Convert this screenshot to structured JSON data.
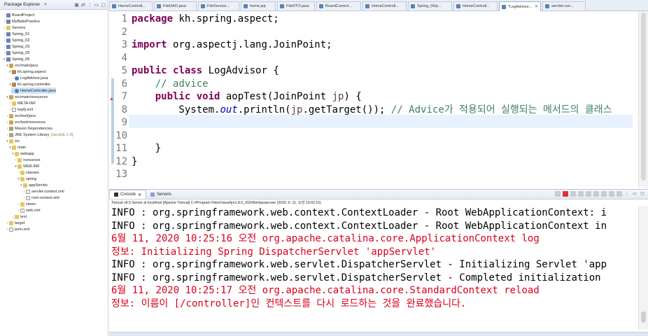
{
  "explorer": {
    "title": "Package Explorer",
    "tree": [
      {
        "label": "BoardProject",
        "icon": "project-icon"
      },
      {
        "label": "MyBatisPractice",
        "icon": "project-icon"
      },
      {
        "label": "Servers",
        "icon": "folder-icon"
      },
      {
        "label": "Spring_01",
        "icon": "project-icon"
      },
      {
        "label": "Spring_02",
        "icon": "project-icon"
      },
      {
        "label": "Spring_03",
        "icon": "project-icon"
      },
      {
        "label": "Spring_05",
        "icon": "project-icon"
      },
      {
        "label": "Spring_06",
        "icon": "project-icon"
      },
      {
        "label": "src/main/java",
        "icon": "source-folder-icon"
      },
      {
        "label": "kh.spring.aspect",
        "icon": "package-icon"
      },
      {
        "label": "LogAdvisor.java",
        "icon": "java-file-icon"
      },
      {
        "label": "kh.spring.controller",
        "icon": "package-icon"
      },
      {
        "label": "HomeController.java",
        "icon": "java-file-icon"
      },
      {
        "label": "src/main/resources",
        "icon": "source-folder-icon"
      },
      {
        "label": "META-INF",
        "icon": "folder-icon"
      },
      {
        "label": "log4j.xml",
        "icon": "xml-file-icon"
      },
      {
        "label": "src/test/java",
        "icon": "source-folder-icon"
      },
      {
        "label": "src/test/resources",
        "icon": "source-folder-icon"
      },
      {
        "label": "Maven Dependencies",
        "icon": "library-icon"
      },
      {
        "label": "JRE System Library",
        "note": "[JavaSE-1.8]",
        "icon": "library-icon"
      },
      {
        "label": "src",
        "icon": "folder-icon"
      },
      {
        "label": "main",
        "icon": "folder-icon"
      },
      {
        "label": "webapp",
        "icon": "folder-icon"
      },
      {
        "label": "resources",
        "icon": "folder-icon"
      },
      {
        "label": "WEB-INF",
        "icon": "folder-icon"
      },
      {
        "label": "classes",
        "icon": "folder-icon"
      },
      {
        "label": "spring",
        "icon": "folder-icon"
      },
      {
        "label": "appServlet",
        "icon": "folder-icon"
      },
      {
        "label": "servlet-context.xml",
        "icon": "xml-file-icon"
      },
      {
        "label": "root-context.xml",
        "icon": "xml-file-icon"
      },
      {
        "label": "views",
        "icon": "folder-icon"
      },
      {
        "label": "web.xml",
        "icon": "xml-file-icon"
      },
      {
        "label": "test",
        "icon": "folder-icon"
      },
      {
        "label": "target",
        "icon": "folder-icon"
      },
      {
        "label": "pom.xml",
        "icon": "xml-file-icon"
      }
    ]
  },
  "tabs": [
    {
      "label": "HomeControll..."
    },
    {
      "label": "FileDAO.java"
    },
    {
      "label": "FileService..."
    },
    {
      "label": "home.jsp"
    },
    {
      "label": "FileDTO.java"
    },
    {
      "label": "BoardControl..."
    },
    {
      "label": "HomeControll..."
    },
    {
      "label": "Spring_06/p..."
    },
    {
      "label": "HomeControll..."
    },
    {
      "label": "*LogAdvisor...",
      "active": true
    },
    {
      "label": "servlet-con..."
    }
  ],
  "editor": {
    "line_numbers": [
      "1",
      "2",
      "3",
      "4",
      "5",
      "6",
      "7",
      "8",
      "9",
      "10",
      "11",
      "12",
      "13"
    ],
    "lines": {
      "l1_kw": "package",
      "l1_rest": " kh.spring.aspect;",
      "l3_kw": "import",
      "l3_rest": " org.aspectj.lang.JoinPoint;",
      "l5_kw1": "public",
      "l5_kw2": "class",
      "l5_rest": " LogAdvisor {",
      "l6_comment": "    // advice",
      "l7_kw1": "public",
      "l7_kw2": "void",
      "l7_mid": " aopTest(JoinPoint ",
      "l7_var": "jp",
      "l7_end": ") {",
      "l8_a": "        System.",
      "l8_field": "out",
      "l8_b": ".println(",
      "l8_var": "jp",
      "l8_c": ".getTarget()); ",
      "l8_comment": "// Advice가 적용되어 실행되는 메서드의 클래스",
      "l11": "    }",
      "l12": "}"
    }
  },
  "console": {
    "tabs": [
      {
        "label": "Console"
      },
      {
        "label": "Servers"
      }
    ],
    "status": "Tomcat v8.5 Server at localhost [Apache Tomcat] C:#Program Files#Java#jre1.8.0_202#bin#javaw.exe (2020. 6. 11. 오전 10:02:15)",
    "lines": [
      {
        "text": "INFO : org.springframework.web.context.ContextLoader - Root WebApplicationContext: i",
        "level": "info"
      },
      {
        "text": "INFO : org.springframework.web.context.ContextLoader - Root WebApplicationContext in",
        "level": "info"
      },
      {
        "text": "6월 11, 2020 10:25:16 오전 org.apache.catalina.core.ApplicationContext log",
        "level": "error"
      },
      {
        "text": "정보: Initializing Spring DispatcherServlet 'appServlet'",
        "level": "error"
      },
      {
        "text": "INFO : org.springframework.web.servlet.DispatcherServlet - Initializing Servlet 'app",
        "level": "info"
      },
      {
        "text": "INFO : org.springframework.web.servlet.DispatcherServlet - Completed initialization",
        "level": "info"
      },
      {
        "text": "6월 11, 2020 10:25:17 오전 org.apache.catalina.core.StandardContext reload",
        "level": "error"
      },
      {
        "text": "정보: 이름이 [/controller]인 컨텍스트를 다시 로드하는 것을 완료했습니다.",
        "level": "error"
      }
    ]
  },
  "colors": {
    "keyword": "#7f0055",
    "comment": "#3f7f5f",
    "field": "#0000c0",
    "console_error": "#d8001c",
    "current_line": "#e8f2fe"
  }
}
